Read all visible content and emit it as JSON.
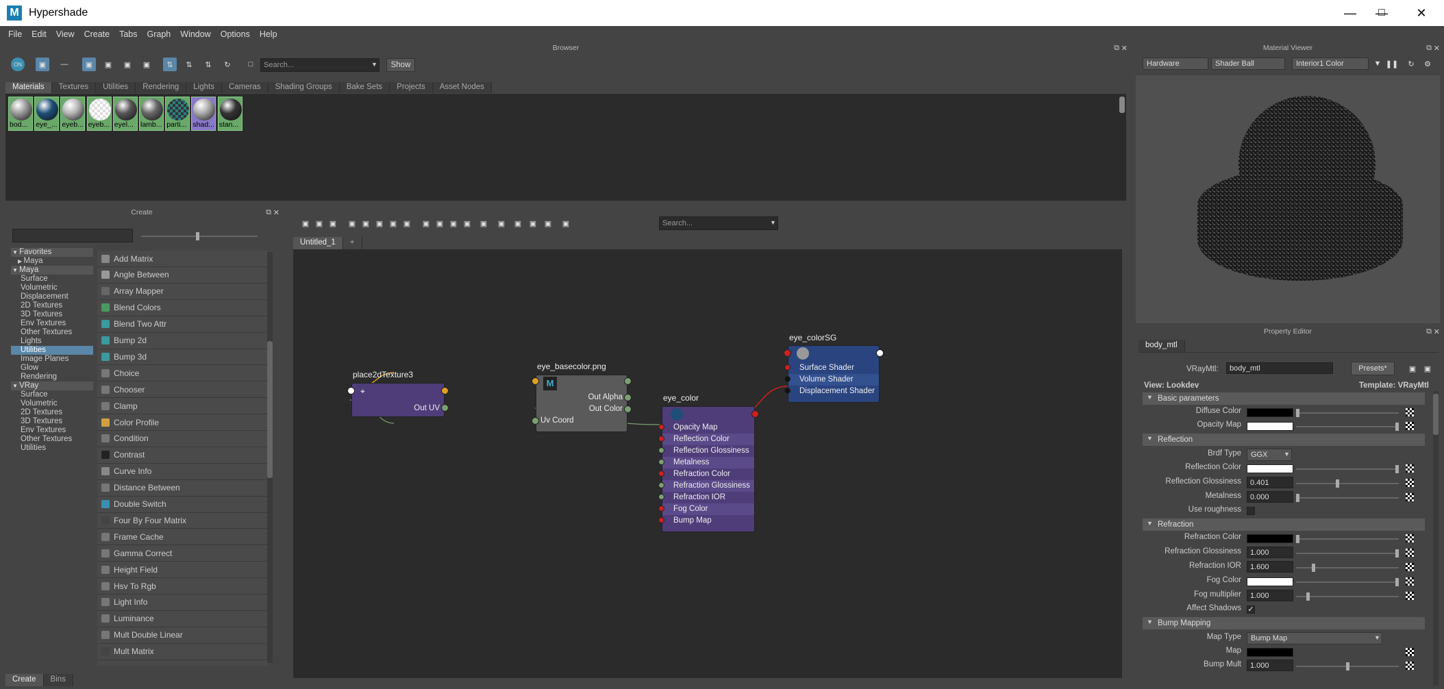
{
  "window": {
    "title": "Hypershade",
    "logo": "M"
  },
  "menu": [
    "File",
    "Edit",
    "View",
    "Create",
    "Tabs",
    "Graph",
    "Window",
    "Options",
    "Help"
  ],
  "browser": {
    "title": "Browser",
    "search_placeholder": "Search...",
    "show_label": "Show",
    "tabs": [
      "Materials",
      "Textures",
      "Utilities",
      "Rendering",
      "Lights",
      "Cameras",
      "Shading Groups",
      "Bake Sets",
      "Projects",
      "Asset Nodes"
    ],
    "active_tab": "Materials",
    "swatches": [
      {
        "label": "bod...",
        "color": "#999"
      },
      {
        "label": "eye_...",
        "color": "#1d4f78"
      },
      {
        "label": "eyeb...",
        "color": "#b5b5b5"
      },
      {
        "label": "eyeb...",
        "color": "checker"
      },
      {
        "label": "eyel...",
        "color": "#555"
      },
      {
        "label": "lamb...",
        "color": "#666"
      },
      {
        "label": "parti...",
        "color": "checker-teal"
      },
      {
        "label": "shad...",
        "color": "#aaa"
      },
      {
        "label": "stan...",
        "color": "#333"
      }
    ]
  },
  "material_viewer": {
    "title": "Material Viewer",
    "renderer": "Hardware",
    "geometry": "Shader Ball",
    "environment": "Interior1 Color"
  },
  "create": {
    "title": "Create",
    "tree": [
      {
        "label": "Favorites",
        "kind": "hdr"
      },
      {
        "label": "Maya",
        "kind": "child-arrow"
      },
      {
        "label": "Maya",
        "kind": "hdr"
      },
      {
        "label": "Surface"
      },
      {
        "label": "Volumetric"
      },
      {
        "label": "Displacement"
      },
      {
        "label": "2D Textures"
      },
      {
        "label": "3D Textures"
      },
      {
        "label": "Env Textures"
      },
      {
        "label": "Other Textures"
      },
      {
        "label": "Lights"
      },
      {
        "label": "Utilities",
        "kind": "sel"
      },
      {
        "label": "Image Planes"
      },
      {
        "label": "Glow"
      },
      {
        "label": "Rendering"
      },
      {
        "label": "VRay",
        "kind": "hdr"
      },
      {
        "label": "Surface"
      },
      {
        "label": "Volumetric"
      },
      {
        "label": "2D Textures"
      },
      {
        "label": "3D Textures"
      },
      {
        "label": "Env Textures"
      },
      {
        "label": "Other Textures"
      },
      {
        "label": "Utilities"
      }
    ],
    "items": [
      "Add Matrix",
      "Angle Between",
      "Array Mapper",
      "Blend Colors",
      "Blend Two Attr",
      "Bump 2d",
      "Bump 3d",
      "Choice",
      "Chooser",
      "Clamp",
      "Color Profile",
      "Condition",
      "Contrast",
      "Curve Info",
      "Distance Between",
      "Double Switch",
      "Four By Four Matrix",
      "Frame Cache",
      "Gamma Correct",
      "Height Field",
      "Hsv To Rgb",
      "Light Info",
      "Luminance",
      "Mult Double Linear",
      "Mult Matrix"
    ],
    "bottom_tabs": [
      "Create",
      "Bins"
    ]
  },
  "graph": {
    "search_placeholder": "Search...",
    "tab": "Untitled_1",
    "add_tab": "+",
    "nodes": {
      "place2d": {
        "title": "place2dTexture3",
        "out": "Out UV"
      },
      "file": {
        "title": "eye_basecolor.png",
        "logo": "M",
        "out_alpha": "Out Alpha",
        "out_color": "Out Color",
        "in_uv": "Uv Coord"
      },
      "mtl": {
        "title": "eye_color",
        "attrs": [
          "Opacity Map",
          "Reflection Color",
          "Reflection Glossiness",
          "Metalness",
          "Refraction Color",
          "Refraction Glossiness",
          "Refraction IOR",
          "Fog Color",
          "Bump Map"
        ]
      },
      "sg": {
        "title": "eye_colorSG",
        "attrs": [
          "Surface Shader",
          "Volume Shader",
          "Displacement Shader"
        ]
      }
    }
  },
  "property_editor": {
    "title": "Property Editor",
    "tab": "body_mtl",
    "type_label": "VRayMtl:",
    "name_value": "body_mtl",
    "presets": "Presets*",
    "view": "View: Lookdev",
    "template": "Template: VRayMtl",
    "sections": {
      "basic": "Basic parameters",
      "refl": "Reflection",
      "refr": "Refraction",
      "bump": "Bump Mapping"
    },
    "rows": {
      "diffuse": "Diffuse Color",
      "opacity": "Opacity Map",
      "brdf": "Brdf Type",
      "brdf_value": "GGX",
      "refl_color": "Reflection Color",
      "refl_gloss": "Reflection Glossiness",
      "refl_gloss_value": "0.401",
      "metal": "Metalness",
      "metal_value": "0.000",
      "use_rough": "Use roughness",
      "refr_color": "Refraction Color",
      "refr_gloss": "Refraction Glossiness",
      "refr_gloss_value": "1.000",
      "refr_ior": "Refraction IOR",
      "refr_ior_value": "1.600",
      "fog": "Fog Color",
      "fog_mult": "Fog multiplier",
      "fog_mult_value": "1.000",
      "affect": "Affect Shadows",
      "maptype": "Map Type",
      "maptype_value": "Bump Map",
      "map": "Map",
      "bump_mult": "Bump Mult",
      "bump_mult_value": "1.000"
    }
  },
  "colors": {
    "accent": "#5a86a8",
    "swatch_green": "#6aa86a",
    "node_purple": "#4f3d7a",
    "node_blue": "#2a4480",
    "grid_bg": "#2b2b2b"
  }
}
